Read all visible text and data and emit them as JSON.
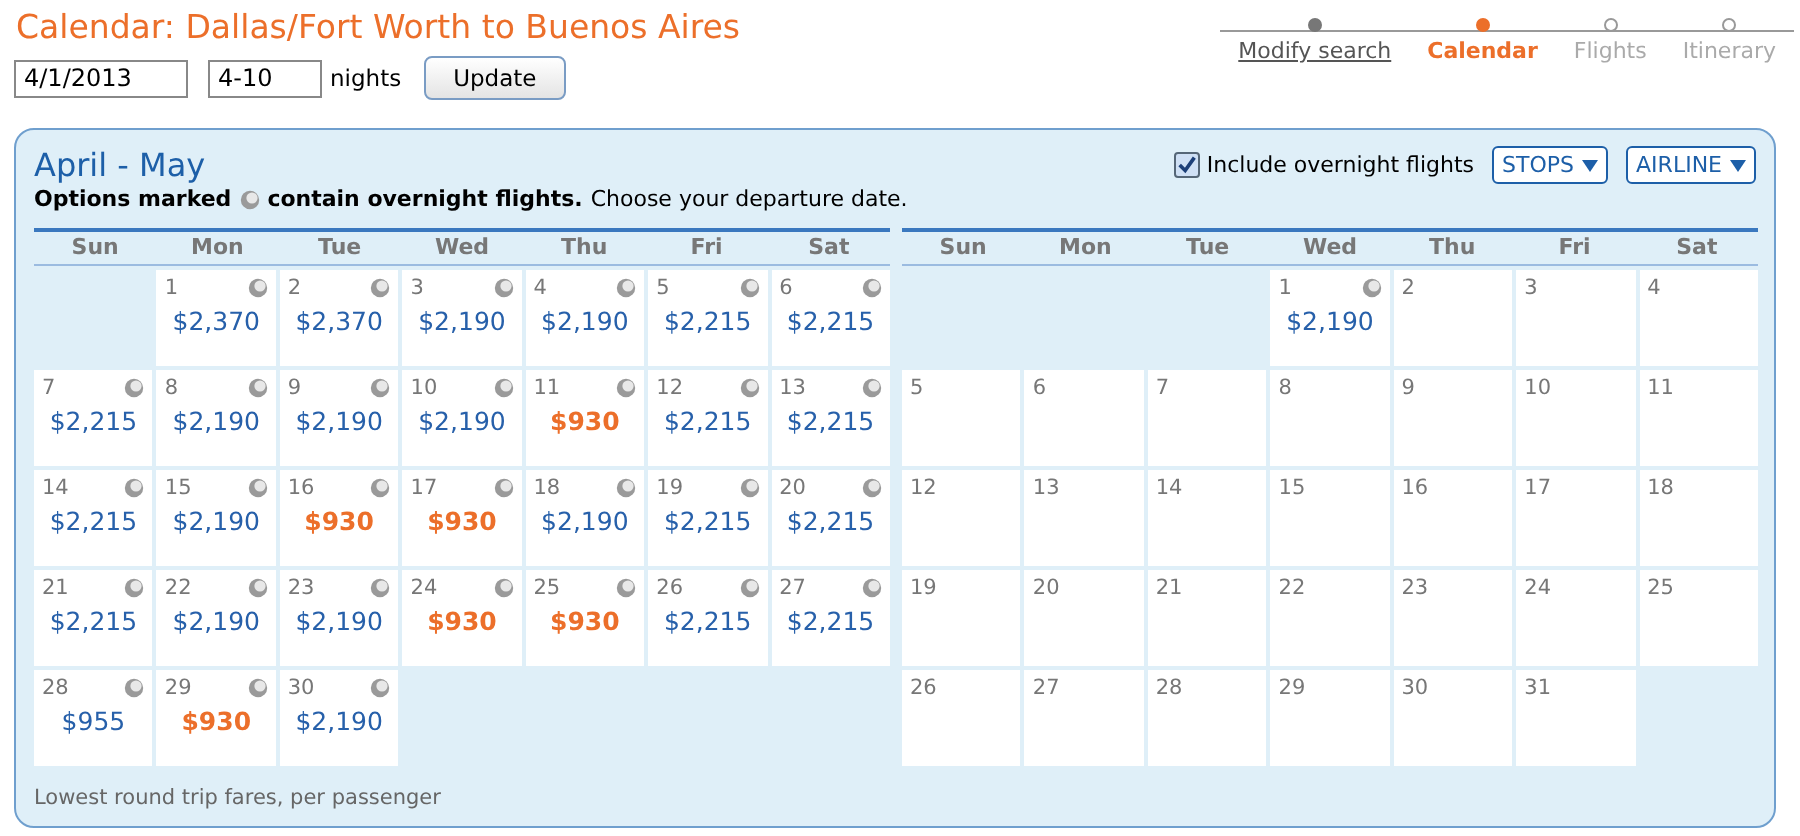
{
  "title": "Calendar: Dallas/Fort Worth to Buenos Aires",
  "search": {
    "date": "4/1/2013",
    "nights": "4-10",
    "nights_label": "nights",
    "button": "Update"
  },
  "steps": [
    {
      "label": "Modify search",
      "completed": true,
      "selected": false
    },
    {
      "label": "Calendar",
      "completed": false,
      "selected": true
    },
    {
      "label": "Flights",
      "completed": false,
      "selected": false
    },
    {
      "label": "Itinerary",
      "completed": false,
      "selected": false
    }
  ],
  "panel": {
    "heading": "April - May",
    "legend": {
      "before": "Options marked",
      "after": "contain overnight flights.",
      "note": "Choose your departure date."
    },
    "overnight_filter": {
      "label": "Include overnight flights",
      "checked": true
    },
    "filters": [
      "STOPS",
      "AIRLINE"
    ],
    "months": [
      {
        "weekdays": [
          "Sun",
          "Mon",
          "Tue",
          "Wed",
          "Thu",
          "Fri",
          "Sat"
        ],
        "weeks": [
          [
            {
              "kind": "blank"
            },
            {
              "kind": "day",
              "date": "1",
              "fare": "$2,370",
              "overnight": true,
              "lowest": false
            },
            {
              "kind": "day",
              "date": "2",
              "fare": "$2,370",
              "overnight": true,
              "lowest": false
            },
            {
              "kind": "day",
              "date": "3",
              "fare": "$2,190",
              "overnight": true,
              "lowest": false
            },
            {
              "kind": "day",
              "date": "4",
              "fare": "$2,190",
              "overnight": true,
              "lowest": false
            },
            {
              "kind": "day",
              "date": "5",
              "fare": "$2,215",
              "overnight": true,
              "lowest": false
            },
            {
              "kind": "day",
              "date": "6",
              "fare": "$2,215",
              "overnight": true,
              "lowest": false
            }
          ],
          [
            {
              "kind": "day",
              "date": "7",
              "fare": "$2,215",
              "overnight": true,
              "lowest": false
            },
            {
              "kind": "day",
              "date": "8",
              "fare": "$2,190",
              "overnight": true,
              "lowest": false
            },
            {
              "kind": "day",
              "date": "9",
              "fare": "$2,190",
              "overnight": true,
              "lowest": false
            },
            {
              "kind": "day",
              "date": "10",
              "fare": "$2,190",
              "overnight": true,
              "lowest": false
            },
            {
              "kind": "day",
              "date": "11",
              "fare": "$930",
              "overnight": true,
              "lowest": true
            },
            {
              "kind": "day",
              "date": "12",
              "fare": "$2,215",
              "overnight": true,
              "lowest": false
            },
            {
              "kind": "day",
              "date": "13",
              "fare": "$2,215",
              "overnight": true,
              "lowest": false
            }
          ],
          [
            {
              "kind": "day",
              "date": "14",
              "fare": "$2,215",
              "overnight": true,
              "lowest": false
            },
            {
              "kind": "day",
              "date": "15",
              "fare": "$2,190",
              "overnight": true,
              "lowest": false
            },
            {
              "kind": "day",
              "date": "16",
              "fare": "$930",
              "overnight": true,
              "lowest": true
            },
            {
              "kind": "day",
              "date": "17",
              "fare": "$930",
              "overnight": true,
              "lowest": true
            },
            {
              "kind": "day",
              "date": "18",
              "fare": "$2,190",
              "overnight": true,
              "lowest": false
            },
            {
              "kind": "day",
              "date": "19",
              "fare": "$2,215",
              "overnight": true,
              "lowest": false
            },
            {
              "kind": "day",
              "date": "20",
              "fare": "$2,215",
              "overnight": true,
              "lowest": false
            }
          ],
          [
            {
              "kind": "day",
              "date": "21",
              "fare": "$2,215",
              "overnight": true,
              "lowest": false
            },
            {
              "kind": "day",
              "date": "22",
              "fare": "$2,190",
              "overnight": true,
              "lowest": false
            },
            {
              "kind": "day",
              "date": "23",
              "fare": "$2,190",
              "overnight": true,
              "lowest": false
            },
            {
              "kind": "day",
              "date": "24",
              "fare": "$930",
              "overnight": true,
              "lowest": true
            },
            {
              "kind": "day",
              "date": "25",
              "fare": "$930",
              "overnight": true,
              "lowest": true
            },
            {
              "kind": "day",
              "date": "26",
              "fare": "$2,215",
              "overnight": true,
              "lowest": false
            },
            {
              "kind": "day",
              "date": "27",
              "fare": "$2,215",
              "overnight": true,
              "lowest": false
            }
          ],
          [
            {
              "kind": "day",
              "date": "28",
              "fare": "$955",
              "overnight": true,
              "lowest": false
            },
            {
              "kind": "day",
              "date": "29",
              "fare": "$930",
              "overnight": true,
              "lowest": true
            },
            {
              "kind": "day",
              "date": "30",
              "fare": "$2,190",
              "overnight": true,
              "lowest": false
            },
            {
              "kind": "blank"
            },
            {
              "kind": "blank"
            },
            {
              "kind": "blank"
            },
            {
              "kind": "blank"
            }
          ]
        ]
      },
      {
        "weekdays": [
          "Sun",
          "Mon",
          "Tue",
          "Wed",
          "Thu",
          "Fri",
          "Sat"
        ],
        "weeks": [
          [
            {
              "kind": "blank"
            },
            {
              "kind": "blank"
            },
            {
              "kind": "blank"
            },
            {
              "kind": "day",
              "date": "1",
              "fare": "$2,190",
              "overnight": true,
              "lowest": false
            },
            {
              "kind": "day",
              "date": "2"
            },
            {
              "kind": "day",
              "date": "3"
            },
            {
              "kind": "day",
              "date": "4"
            }
          ],
          [
            {
              "kind": "day",
              "date": "5"
            },
            {
              "kind": "day",
              "date": "6"
            },
            {
              "kind": "day",
              "date": "7"
            },
            {
              "kind": "day",
              "date": "8"
            },
            {
              "kind": "day",
              "date": "9"
            },
            {
              "kind": "day",
              "date": "10"
            },
            {
              "kind": "day",
              "date": "11"
            }
          ],
          [
            {
              "kind": "day",
              "date": "12"
            },
            {
              "kind": "day",
              "date": "13"
            },
            {
              "kind": "day",
              "date": "14"
            },
            {
              "kind": "day",
              "date": "15"
            },
            {
              "kind": "day",
              "date": "16"
            },
            {
              "kind": "day",
              "date": "17"
            },
            {
              "kind": "day",
              "date": "18"
            }
          ],
          [
            {
              "kind": "day",
              "date": "19"
            },
            {
              "kind": "day",
              "date": "20"
            },
            {
              "kind": "day",
              "date": "21"
            },
            {
              "kind": "day",
              "date": "22"
            },
            {
              "kind": "day",
              "date": "23"
            },
            {
              "kind": "day",
              "date": "24"
            },
            {
              "kind": "day",
              "date": "25"
            }
          ],
          [
            {
              "kind": "day",
              "date": "26"
            },
            {
              "kind": "day",
              "date": "27"
            },
            {
              "kind": "day",
              "date": "28"
            },
            {
              "kind": "day",
              "date": "29"
            },
            {
              "kind": "day",
              "date": "30"
            },
            {
              "kind": "day",
              "date": "31"
            },
            {
              "kind": "blank"
            }
          ]
        ]
      }
    ],
    "footnote": "Lowest round trip fares, per passenger"
  }
}
